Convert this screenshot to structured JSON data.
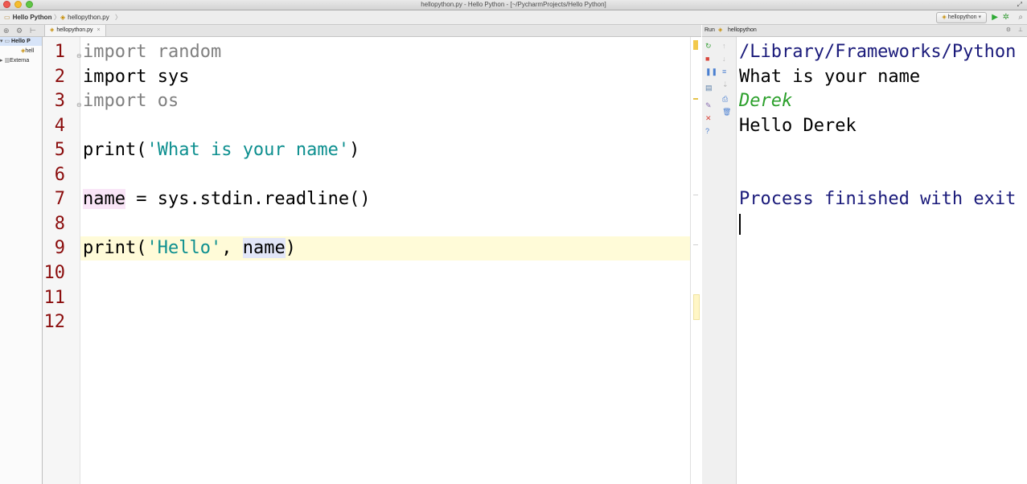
{
  "window": {
    "title": "hellopython.py - Hello Python - [~/PycharmProjects/Hello Python]"
  },
  "navbar": {
    "project_crumb": "Hello Python",
    "file_crumb": "hellopython.py",
    "run_config": "hellopython"
  },
  "editor": {
    "tab_label": "hellopython.py",
    "line_numbers": [
      "1",
      "2",
      "3",
      "4",
      "5",
      "6",
      "7",
      "8",
      "9",
      "10",
      "11",
      "12"
    ],
    "lines": {
      "l1_kw": "import random",
      "l2": "import sys",
      "l3_kw": "import os",
      "l5_a": "print(",
      "l5_str": "'What is your name'",
      "l5_b": ")",
      "l7_name": "name",
      "l7_rest": " = sys.stdin.readline()",
      "l9_a": "print(",
      "l9_str": "'Hello'",
      "l9_b": ", ",
      "l9_name": "name",
      "l9_c": ")"
    }
  },
  "project_panel": {
    "root": "Hello P",
    "file": "hell",
    "external": "Externa"
  },
  "run_panel": {
    "label": "Run",
    "config": "hellopython",
    "console": {
      "path": "/Library/Frameworks/Python",
      "prompt": "What is your name",
      "input": "Derek",
      "output": "Hello Derek",
      "exit": "Process finished with exit"
    }
  },
  "icons": {
    "run": "run-icon",
    "debug": "debug-icon",
    "search": "search-icon",
    "rerun": "rerun-icon",
    "stop": "stop-icon",
    "pause": "pause-icon",
    "close": "close-icon",
    "help": "help-icon"
  },
  "colors": {
    "line_number": "#8b0d0d",
    "string": "#0d8f8f",
    "console_input": "#2ca02c",
    "caret_row": "#fffbd8"
  }
}
